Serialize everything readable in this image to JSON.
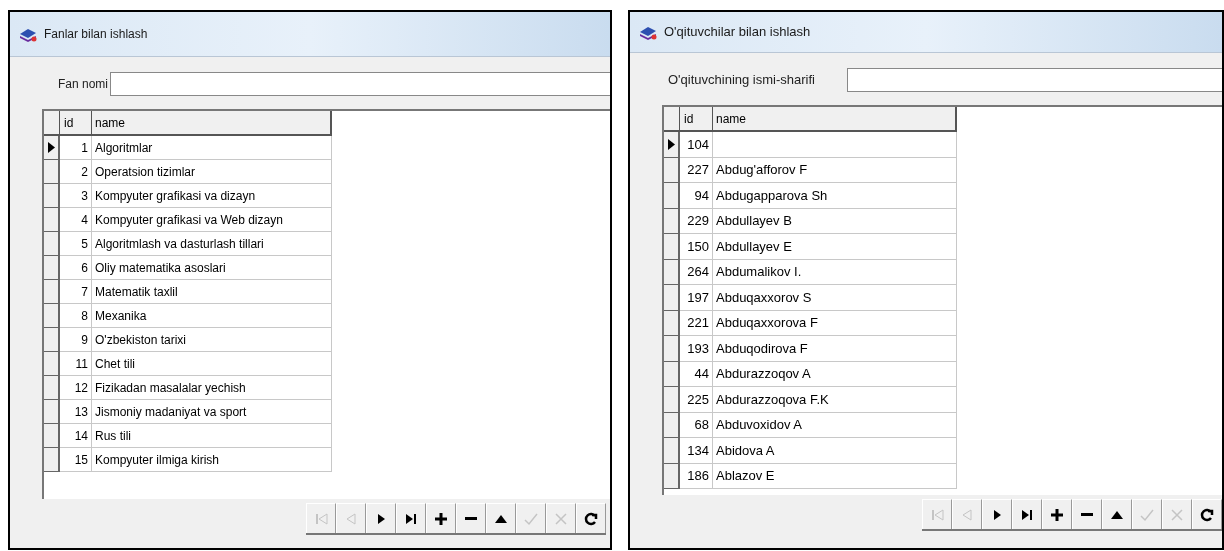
{
  "windows": [
    {
      "title": "Fanlar bilan ishlash",
      "field": {
        "label": "Fan nomi"
      },
      "table": {
        "columns": [
          "id",
          "name"
        ],
        "rows": [
          {
            "id": "1",
            "name": "Algoritmlar",
            "selected": true
          },
          {
            "id": "2",
            "name": "Operatsion tizimlar",
            "selected": false
          },
          {
            "id": "3",
            "name": "Kompyuter grafikasi va dizayn",
            "selected": false
          },
          {
            "id": "4",
            "name": "Kompyuter grafikasi va Web dizayn",
            "selected": false
          },
          {
            "id": "5",
            "name": "Algoritmlash va dasturlash tillari",
            "selected": false
          },
          {
            "id": "6",
            "name": "Oliy matematika asoslari",
            "selected": false
          },
          {
            "id": "7",
            "name": "Matematik taxlil",
            "selected": false
          },
          {
            "id": "8",
            "name": "Mexanika",
            "selected": false
          },
          {
            "id": "9",
            "name": "O'zbekiston tarixi",
            "selected": false
          },
          {
            "id": "11",
            "name": "Chet tili",
            "selected": false
          },
          {
            "id": "12",
            "name": "Fizikadan masalalar yechish",
            "selected": false
          },
          {
            "id": "13",
            "name": "Jismoniy madaniyat va sport",
            "selected": false
          },
          {
            "id": "14",
            "name": "Rus tili",
            "selected": false
          },
          {
            "id": "15",
            "name": "Kompyuter ilmiga kirish",
            "selected": false
          }
        ]
      },
      "navigator": [
        {
          "kind": "first",
          "disabled": true
        },
        {
          "kind": "prior",
          "disabled": true
        },
        {
          "kind": "next",
          "disabled": false
        },
        {
          "kind": "last",
          "disabled": false
        },
        {
          "kind": "insert",
          "disabled": false
        },
        {
          "kind": "delete",
          "disabled": false
        },
        {
          "kind": "edit",
          "disabled": false
        },
        {
          "kind": "post",
          "disabled": true
        },
        {
          "kind": "cancel",
          "disabled": true
        },
        {
          "kind": "refresh",
          "disabled": false
        }
      ]
    },
    {
      "title": "O'qituvchilar bilan ishlash",
      "field": {
        "label": "O'qituvchining ismi-sharifi"
      },
      "table": {
        "columns": [
          "id",
          "name"
        ],
        "rows": [
          {
            "id": "104",
            "selected": true
          },
          {
            "id": "227",
            "name": "Abdug'afforov F",
            "selected": false
          },
          {
            "id": "94",
            "name": "Abdugapparova Sh",
            "selected": false
          },
          {
            "id": "229",
            "name": "Abdullayev B",
            "selected": false
          },
          {
            "id": "150",
            "name": "Abdullayev E",
            "selected": false
          },
          {
            "id": "264",
            "name": "Abdumalikov I.",
            "selected": false
          },
          {
            "id": "197",
            "name": "Abduqaxxorov S",
            "selected": false
          },
          {
            "id": "221",
            "name": "Abduqaxxorova F",
            "selected": false
          },
          {
            "id": "193",
            "name": "Abduqodirova F",
            "selected": false
          },
          {
            "id": "44",
            "name": "Abdurazzoqov A",
            "selected": false
          },
          {
            "id": "225",
            "name": "Abdurazzoqova F.K",
            "selected": false
          },
          {
            "id": "68",
            "name": "Abduvoxidov A",
            "selected": false
          },
          {
            "id": "134",
            "name": "Abidova A",
            "selected": false
          },
          {
            "id": "186",
            "name": "Ablazov E",
            "selected": false
          }
        ]
      },
      "navigator": [
        {
          "kind": "first",
          "disabled": true
        },
        {
          "kind": "prior",
          "disabled": true
        },
        {
          "kind": "next",
          "disabled": false
        },
        {
          "kind": "last",
          "disabled": false
        },
        {
          "kind": "insert",
          "disabled": false
        },
        {
          "kind": "delete",
          "disabled": false
        },
        {
          "kind": "edit",
          "disabled": false
        },
        {
          "kind": "post",
          "disabled": true
        },
        {
          "kind": "cancel",
          "disabled": true
        },
        {
          "kind": "refresh",
          "disabled": false
        }
      ]
    }
  ]
}
